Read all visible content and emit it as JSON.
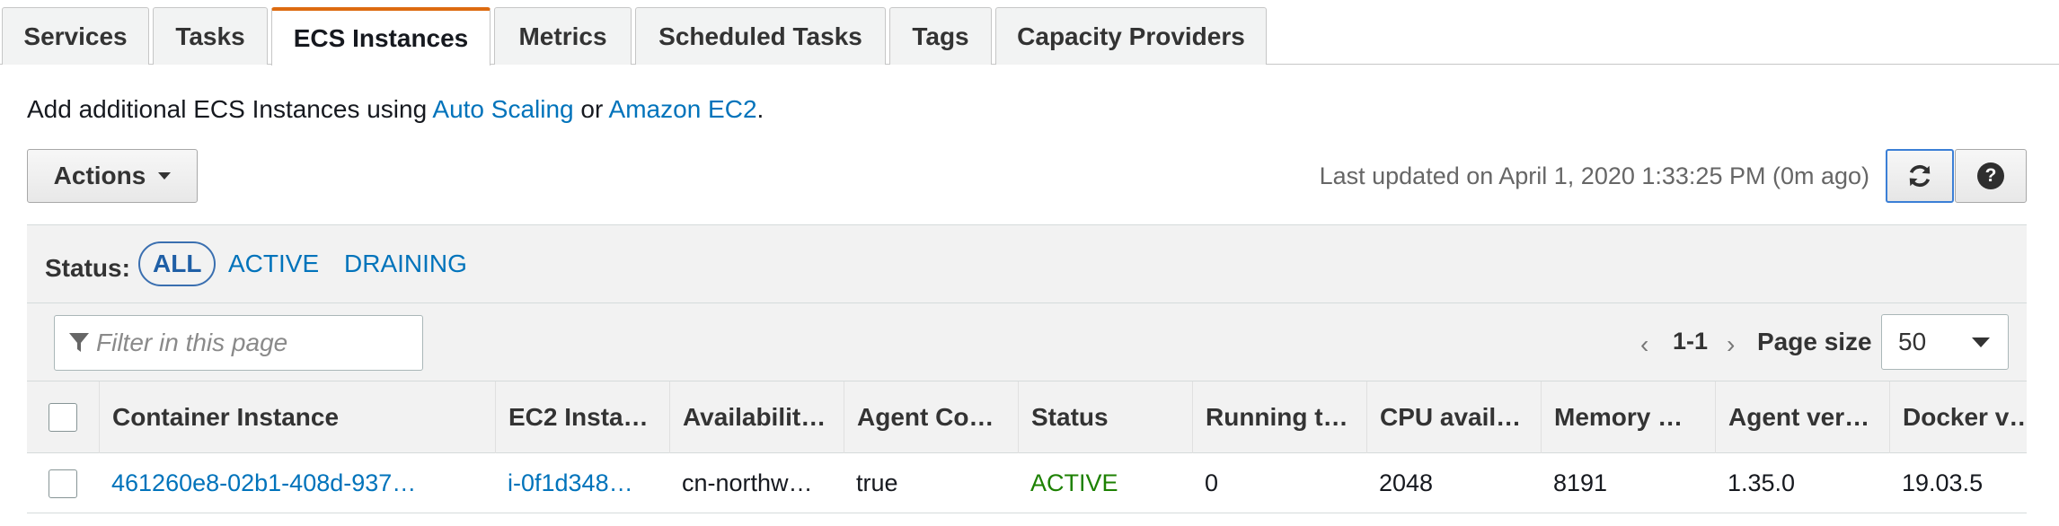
{
  "tabs": [
    {
      "label": "Services"
    },
    {
      "label": "Tasks"
    },
    {
      "label": "ECS Instances"
    },
    {
      "label": "Metrics"
    },
    {
      "label": "Scheduled Tasks"
    },
    {
      "label": "Tags"
    },
    {
      "label": "Capacity Providers"
    }
  ],
  "info": {
    "prefix": "Add additional ECS Instances using ",
    "link1": "Auto Scaling",
    "middle": " or ",
    "link2": "Amazon EC2",
    "suffix": "."
  },
  "toolbar": {
    "actions_label": "Actions",
    "last_updated": "Last updated on April 1, 2020 1:33:25 PM (0m ago)",
    "refresh_icon": "refresh-icon",
    "help_icon": "help-icon",
    "help_glyph": "?"
  },
  "status_filter": {
    "label": "Status:",
    "options": [
      "ALL",
      "ACTIVE",
      "DRAINING"
    ],
    "selected": "ALL"
  },
  "search": {
    "placeholder": "Filter in this page",
    "icon": "filter-icon"
  },
  "pagination": {
    "prev": "‹",
    "range": "1-1",
    "next": "›",
    "page_size_label": "Page size",
    "page_size": "50"
  },
  "table": {
    "columns": [
      "Container Instance",
      "EC2 Insta…",
      "Availabilit…",
      "Agent Co…",
      "Status",
      "Running t…",
      "CPU avail…",
      "Memory …",
      "Agent ver…",
      "Docker v…"
    ],
    "rows": [
      {
        "container_instance": "461260e8-02b1-408d-937…",
        "ec2_instance": "i-0f1d348…",
        "availability": "cn-northw…",
        "agent_connected": "true",
        "status": "ACTIVE",
        "running_tasks": "0",
        "cpu_available": "2048",
        "memory": "8191",
        "agent_version": "1.35.0",
        "docker_version": "19.03.5"
      }
    ]
  },
  "colors": {
    "active_tab_accent": "#dd6b10",
    "link": "#0073bb",
    "status_active": "#1d8102"
  }
}
